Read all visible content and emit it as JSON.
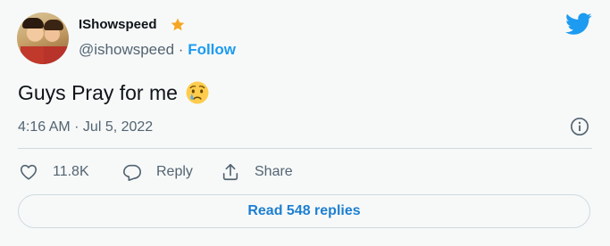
{
  "user": {
    "display_name": "IShowspeed",
    "handle": "@ishowspeed",
    "separator": "·",
    "follow_label": "Follow"
  },
  "tweet": {
    "text": "Guys Pray for me",
    "emoji_icon": "crying-face-emoji",
    "timestamp": "4:16 AM · Jul 5, 2022"
  },
  "actions": {
    "like_count": "11.8K",
    "reply_label": "Reply",
    "share_label": "Share"
  },
  "read_replies_label": "Read 548 replies",
  "colors": {
    "accent": "#1d9bf0",
    "star": "#f6a623",
    "muted": "#536471"
  }
}
